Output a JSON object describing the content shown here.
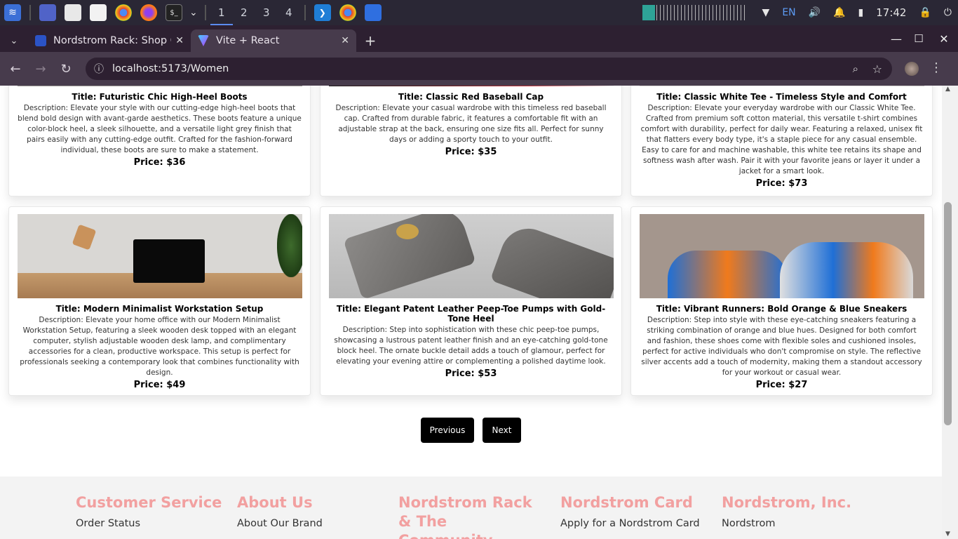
{
  "taskbar": {
    "workspaces": [
      "1",
      "2",
      "3",
      "4"
    ],
    "tray": {
      "lang": "EN",
      "time": "17:42"
    }
  },
  "browser": {
    "tabs": [
      {
        "title": "Nordstrom Rack: Shop Cl"
      },
      {
        "title": "Vite + React"
      }
    ],
    "url": "localhost:5173/Women"
  },
  "products": [
    {
      "title": "Title: Futuristic Chic High-Heel Boots",
      "description": "Description: Elevate your style with our cutting-edge high-heel boots that blend bold design with avant-garde aesthetics. These boots feature a unique color-block heel, a sleek silhouette, and a versatile light grey finish that pairs easily with any cutting-edge outfit. Crafted for the fashion-forward individual, these boots are sure to make a statement.",
      "price": "Price: $36"
    },
    {
      "title": "Title: Classic Red Baseball Cap",
      "description": "Description: Elevate your casual wardrobe with this timeless red baseball cap. Crafted from durable fabric, it features a comfortable fit with an adjustable strap at the back, ensuring one size fits all. Perfect for sunny days or adding a sporty touch to your outfit.",
      "price": "Price: $35"
    },
    {
      "title": "Title: Classic White Tee - Timeless Style and Comfort",
      "description": "Description: Elevate your everyday wardrobe with our Classic White Tee. Crafted from premium soft cotton material, this versatile t-shirt combines comfort with durability, perfect for daily wear. Featuring a relaxed, unisex fit that flatters every body type, it's a staple piece for any casual ensemble. Easy to care for and machine washable, this white tee retains its shape and softness wash after wash. Pair it with your favorite jeans or layer it under a jacket for a smart look.",
      "price": "Price: $73"
    },
    {
      "title": "Title: Modern Minimalist Workstation Setup",
      "description": "Description: Elevate your home office with our Modern Minimalist Workstation Setup, featuring a sleek wooden desk topped with an elegant computer, stylish adjustable wooden desk lamp, and complimentary accessories for a clean, productive workspace. This setup is perfect for professionals seeking a contemporary look that combines functionality with design.",
      "price": "Price: $49"
    },
    {
      "title": "Title: Elegant Patent Leather Peep-Toe Pumps with Gold-Tone Heel",
      "description": "Description: Step into sophistication with these chic peep-toe pumps, showcasing a lustrous patent leather finish and an eye-catching gold-tone block heel. The ornate buckle detail adds a touch of glamour, perfect for elevating your evening attire or complementing a polished daytime look.",
      "price": "Price: $53"
    },
    {
      "title": "Title: Vibrant Runners: Bold Orange & Blue Sneakers",
      "description": "Description: Step into style with these eye-catching sneakers featuring a striking combination of orange and blue hues. Designed for both comfort and fashion, these shoes come with flexible soles and cushioned insoles, perfect for active individuals who don't compromise on style. The reflective silver accents add a touch of modernity, making them a standout accessory for your workout or casual wear.",
      "price": "Price: $27"
    }
  ],
  "pagination": {
    "prev": "Previous",
    "next": "Next"
  },
  "footer": {
    "columns": [
      {
        "heading": "Customer Service",
        "link": "Order Status"
      },
      {
        "heading": "About Us",
        "link": "About Our Brand"
      },
      {
        "heading": "Nordstrom Rack & The Community",
        "link": ""
      },
      {
        "heading": "Nordstrom Card",
        "link": "Apply for a Nordstrom Card"
      },
      {
        "heading": "Nordstrom, Inc.",
        "link": "Nordstrom"
      }
    ],
    "heading_color": "#f2a0a0"
  }
}
